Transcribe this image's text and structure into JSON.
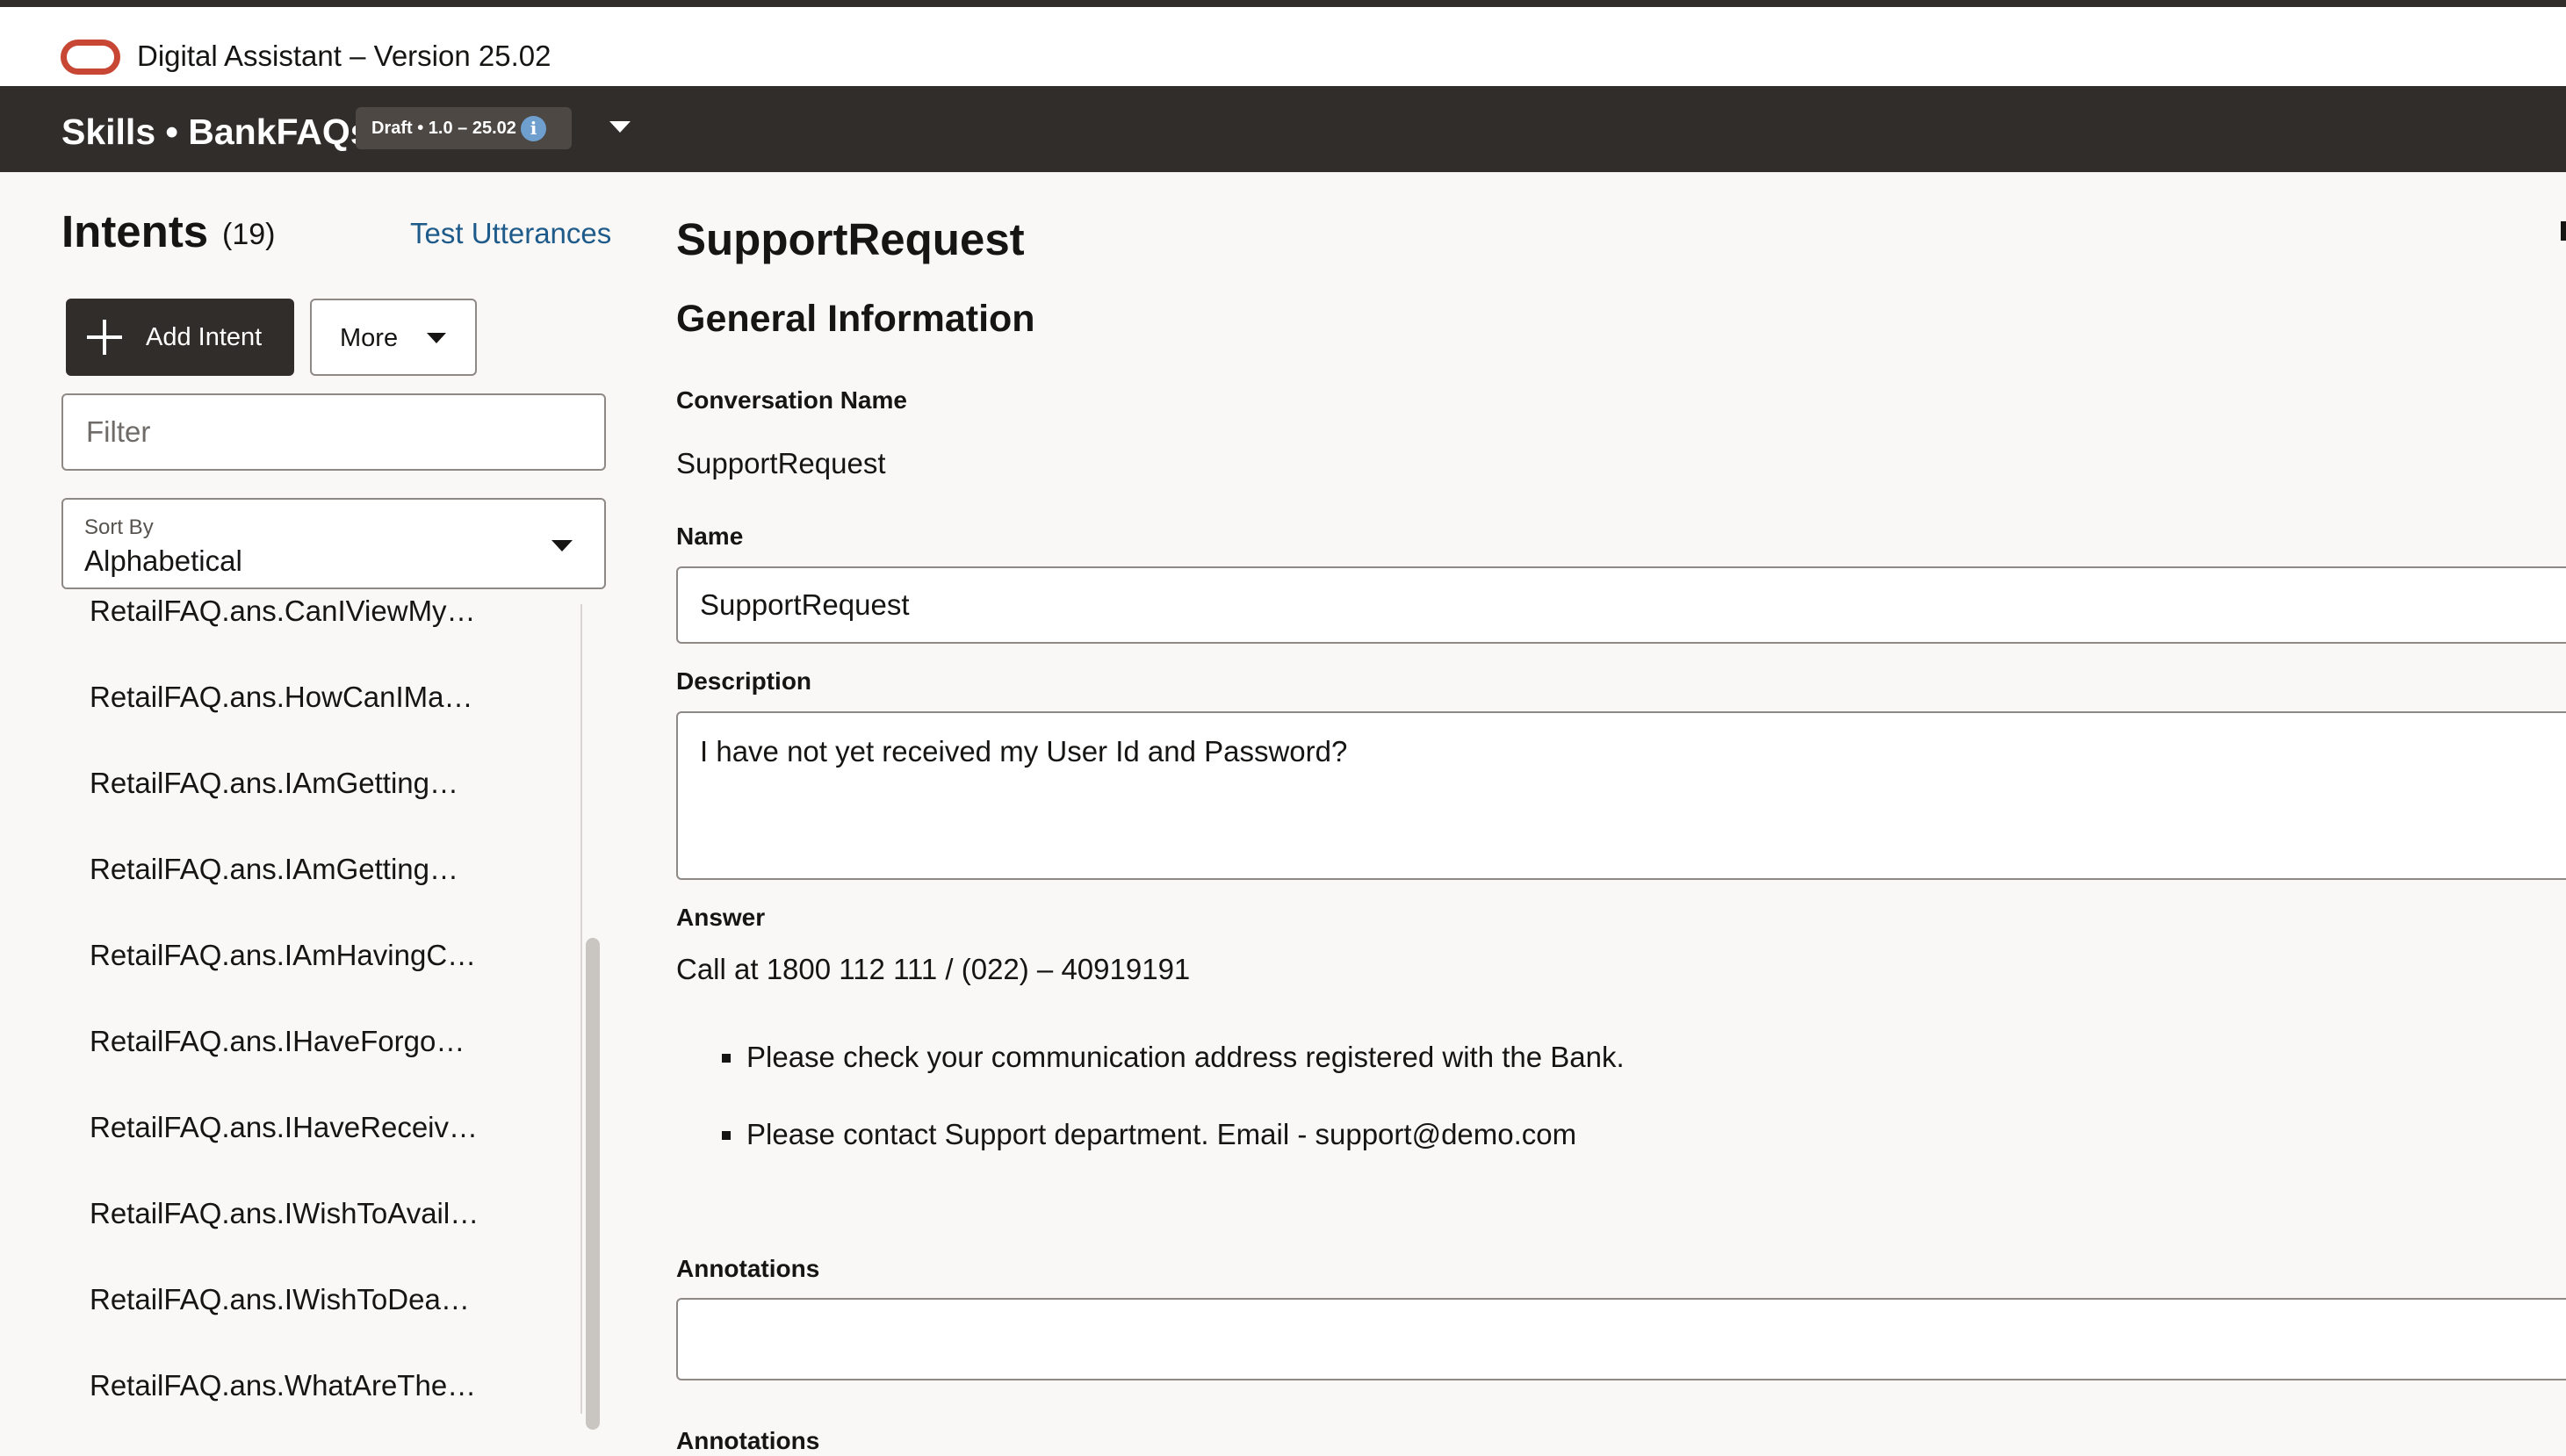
{
  "app": {
    "title": "Digital Assistant – Version 25.02"
  },
  "skillbar": {
    "title": "Skills • BankFAQs",
    "badge": "Draft • 1.0 – 25.02"
  },
  "sidebar": {
    "title": "Intents",
    "count": "(19)",
    "test_link": "Test Utterances",
    "add_button": "Add Intent",
    "more_button": "More",
    "filter_placeholder": "Filter",
    "sort_label": "Sort By",
    "sort_value": "Alphabetical",
    "intents": [
      "RetailFAQ.ans.CanIViewMy…",
      "RetailFAQ.ans.HowCanIMa…",
      "RetailFAQ.ans.IAmGetting…",
      "RetailFAQ.ans.IAmGetting…",
      "RetailFAQ.ans.IAmHavingC…",
      "RetailFAQ.ans.IHaveForgo…",
      "RetailFAQ.ans.IHaveReceiv…",
      "RetailFAQ.ans.IWishToAvail…",
      "RetailFAQ.ans.IWishToDea…",
      "RetailFAQ.ans.WhatAreThe…"
    ]
  },
  "main": {
    "intent_name": "SupportRequest",
    "section_title": "General Information",
    "conversation_name_label": "Conversation Name",
    "conversation_name": "SupportRequest",
    "name_label": "Name",
    "name_value": "SupportRequest",
    "description_label": "Description",
    "description_value": "I have not yet received my User Id and Password?",
    "answer_label": "Answer",
    "answer_line": "Call at 1800 112 111 / (022) – 40919191",
    "answer_bullets": [
      "Please check your communication address registered with the Bank.",
      "Please contact Support department. Email - support@demo.com"
    ],
    "annotations_label": "Annotations",
    "annotations_value": ""
  },
  "colors": {
    "brand": "#c74634",
    "header_bg": "#312d2a",
    "link": "#1e5b8a",
    "info": "#6e9fcf"
  },
  "icons": [
    "oracle-logo",
    "info-icon",
    "chevron-down-icon",
    "plus-icon"
  ]
}
